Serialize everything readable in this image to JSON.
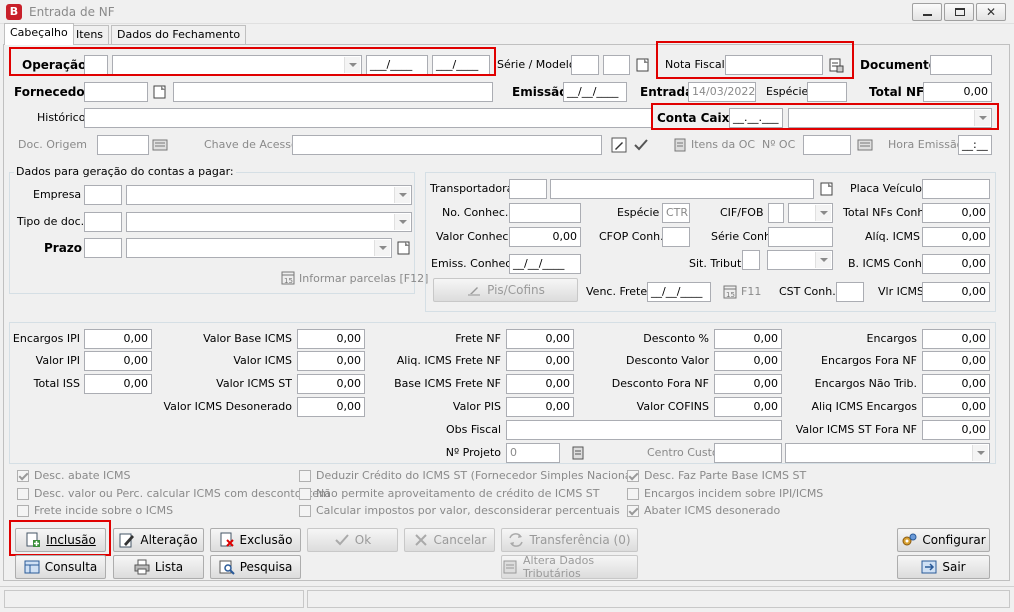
{
  "window": {
    "title": "Entrada de NF",
    "app_letter": "B"
  },
  "tabs": [
    {
      "label": "Cabeçalho"
    },
    {
      "label": "Itens"
    },
    {
      "label": "Dados do Fechamento"
    }
  ],
  "header": {
    "operacao": "Operação",
    "serie_modelo": "Série / Modelo",
    "nota_fiscal": "Nota Fiscal",
    "documento": "Documento",
    "fornecedor": "Fornecedor",
    "emissao": "Emissão",
    "emissao_val": "__/__/____",
    "entrada": "Entrada",
    "entrada_val": "14/03/2022",
    "especie": "Espécie",
    "total_nf": "Total NF",
    "total_nf_val": "0,00",
    "historico": "Histórico",
    "conta_caixa": "Conta Caixa",
    "conta_caixa_mask": "__.__.___",
    "date_mask": "___/____",
    "doc_origem": "Doc. Origem",
    "chave_acesso": "Chave de Acesso",
    "itens_oc": "Itens da OC",
    "n_oc": "Nº OC",
    "hora_emissao": "Hora Emissão",
    "hora_mask": "__:__"
  },
  "contas_pagar": {
    "title": "Dados para geração do contas a pagar:",
    "empresa": "Empresa",
    "tipo_doc": "Tipo de doc.",
    "prazo": "Prazo",
    "informar_parcelas": "Informar parcelas [F12]"
  },
  "transporte": {
    "transportadora": "Transportadora",
    "placa_veiculo": "Placa Veículo",
    "no_conhec": "No. Conhec.",
    "especie": "Espécie",
    "especie_val": "CTR",
    "cif_fob": "CIF/FOB",
    "total_nfs_conh": "Total NFs Conh.",
    "total_nfs_conh_val": "0,00",
    "valor_conhec": "Valor Conhec.",
    "valor_conhec_val": "0,00",
    "cfop_conh": "CFOP Conh.",
    "serie_conh": "Série Conh.",
    "aliq_icms": "Alíq. ICMS",
    "aliq_icms_val": "0,00",
    "emiss_conhec": "Emiss. Conhec.",
    "emiss_val": "__/__/____",
    "sit_tribut": "Sit. Tribut.",
    "b_icms_conh": "B. ICMS Conh.",
    "b_icms_conh_val": "0,00",
    "pis_cofins": "Pis/Cofins",
    "venc_frete": "Venc. Frete",
    "venc_val": "__/__/____",
    "f11": "F11",
    "cst_conh": "CST Conh.",
    "vlr_icms": "Vlr ICMS",
    "vlr_icms_val": "0,00"
  },
  "valores": {
    "encargos_ipi": "Encargos IPI",
    "valor_ipi": "Valor IPI",
    "total_iss": "Total ISS",
    "valor_base_icms": "Valor Base ICMS",
    "valor_icms": "Valor ICMS",
    "valor_icms_st": "Valor ICMS ST",
    "valor_icms_desonerado": "Valor ICMS Desonerado",
    "frete_nf": "Frete NF",
    "aliq_icms_frete_nf": "Aliq. ICMS Frete NF",
    "base_icms_frete_nf": "Base ICMS Frete NF",
    "valor_pis": "Valor PIS",
    "desconto_pct": "Desconto %",
    "desconto_valor": "Desconto Valor",
    "desconto_fora_nf": "Desconto Fora NF",
    "valor_cofins": "Valor COFINS",
    "encargos": "Encargos",
    "encargos_fora_nf": "Encargos Fora NF",
    "encargos_nao_trib": "Encargos Não Trib.",
    "aliq_icms_encargos": "Aliq ICMS Encargos",
    "valor_icms_st_fora_nf": "Valor ICMS ST Fora NF",
    "obs_fiscal": "Obs Fiscal",
    "n_projeto": "Nº Projeto",
    "n_projeto_val": "0",
    "centro_custo": "Centro Custo",
    "zero": "0,00"
  },
  "checks": [
    {
      "label": "Desc. abate ICMS",
      "checked": true
    },
    {
      "label": "Desc. valor ou Perc. calcular ICMS com desconto item",
      "checked": false
    },
    {
      "label": "Frete incide sobre o ICMS",
      "checked": false
    },
    {
      "label": "Deduzir Crédito do ICMS ST (Fornecedor Simples Nacional)",
      "checked": false
    },
    {
      "label": "Não permite aproveitamento de crédito de ICMS ST",
      "checked": false
    },
    {
      "label": "Calcular impostos por valor, desconsiderar percentuais",
      "checked": false
    },
    {
      "label": "Desc. Faz Parte Base ICMS ST",
      "checked": true
    },
    {
      "label": "Encargos incidem sobre IPI/ICMS",
      "checked": false
    },
    {
      "label": "Abater ICMS desonerado",
      "checked": true
    }
  ],
  "buttons": {
    "inclusao": "Inclusão",
    "alteracao": "Alteração",
    "exclusao": "Exclusão",
    "ok": "Ok",
    "cancelar": "Cancelar",
    "transferencia": "Transferência (0)",
    "configurar": "Configurar",
    "consulta": "Consulta",
    "lista": "Lista",
    "pesquisa": "Pesquisa",
    "altera_dados": "Altera Dados Tributários",
    "sair": "Sair"
  },
  "colors": {
    "highlight": "#e00000",
    "app_icon": "#c8202a"
  }
}
